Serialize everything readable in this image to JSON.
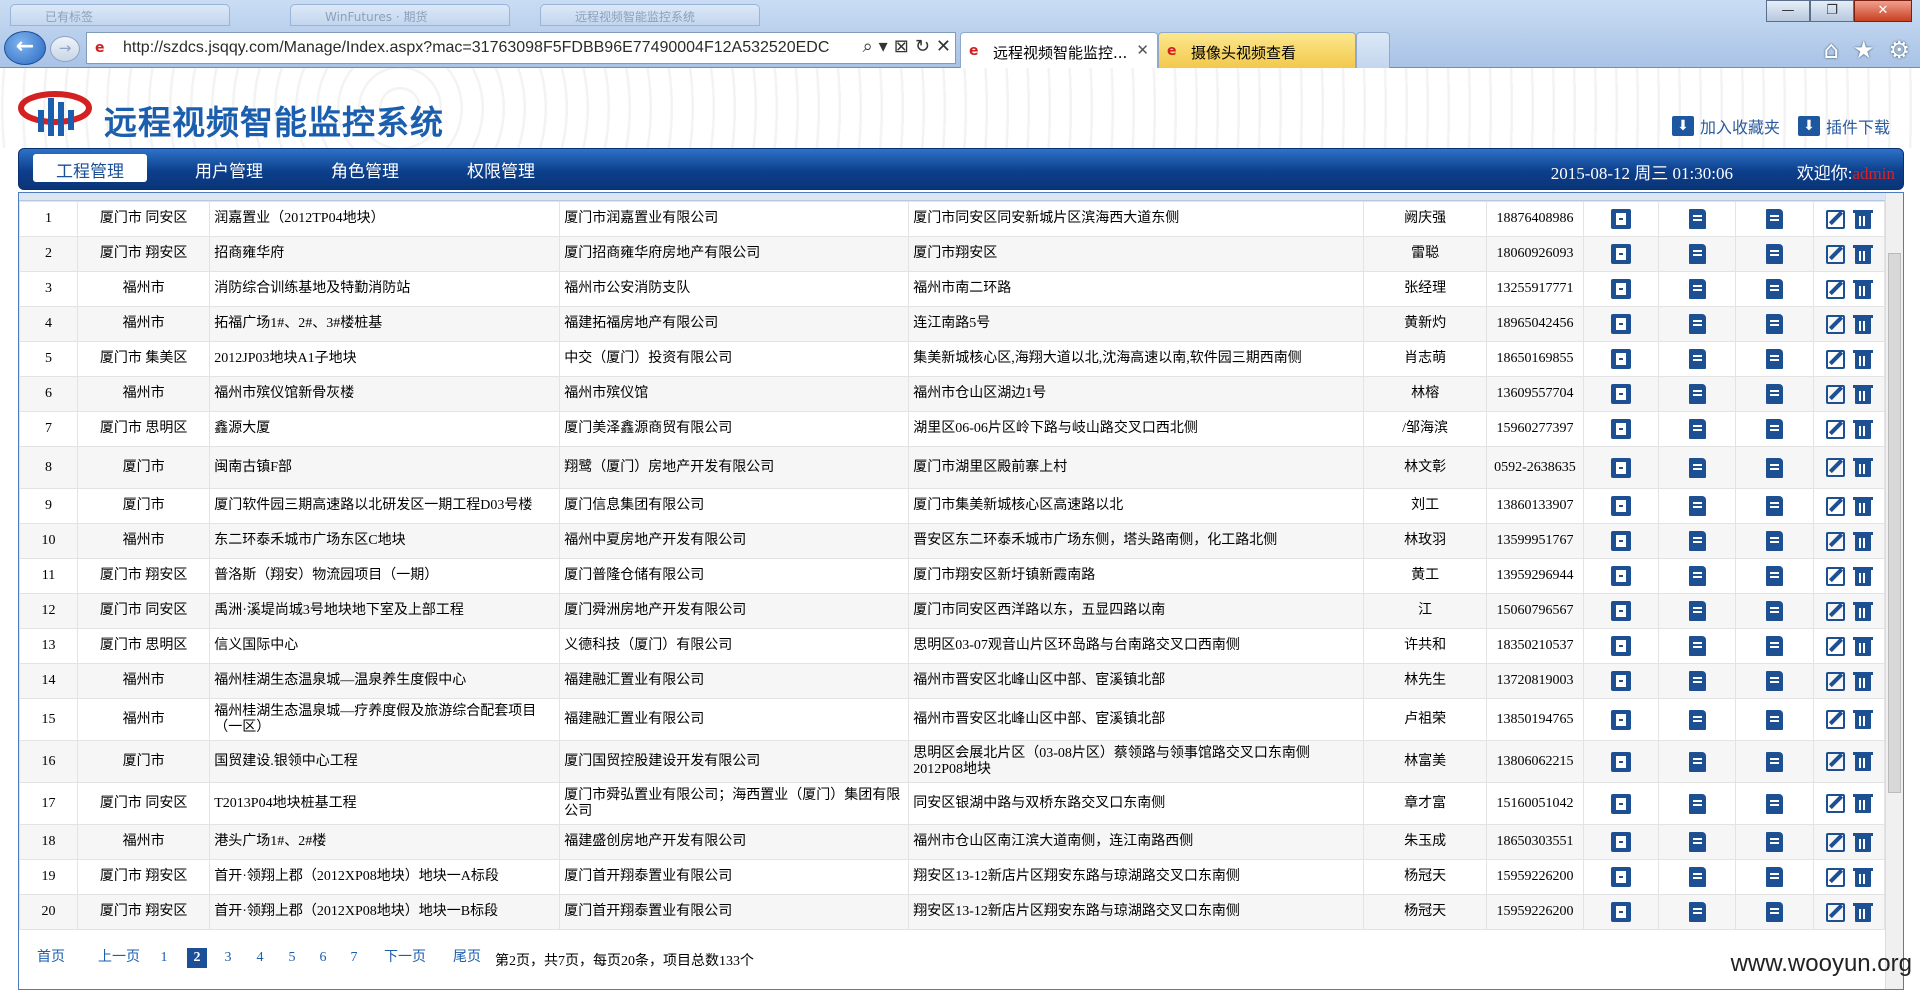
{
  "browser": {
    "back_glyph": "←",
    "forward_glyph": "→",
    "address": "http://szdcs.jsqqy.com/Manage/Index.aspx?mac=31763098F5FDBB96E77490004F12A532520EDC",
    "address_tools": [
      "⌕",
      "▾",
      "⊠",
      "↻",
      "✕"
    ],
    "old_tabs": [
      "已有标签",
      "WinFutures · 期货",
      "远程视频智能监控系统"
    ],
    "tabs": [
      {
        "label": "远程视频智能监控...",
        "active": true
      },
      {
        "label": "摄像头视频查看",
        "active": false
      }
    ],
    "window_buttons": [
      "—",
      "❐",
      "✕"
    ],
    "nav_icons": [
      "⌂",
      "★",
      "⚙"
    ]
  },
  "header": {
    "title": "远程视频智能监控系统",
    "add_favorite": "加入收藏夹",
    "plugin_download": "插件下载",
    "download_glyph": "⬇"
  },
  "navbar": {
    "menus": [
      "工程管理",
      "用户管理",
      "角色管理",
      "权限管理"
    ],
    "active_index": 0,
    "datetime": "2015-08-12 周三 01:30:06",
    "welcome_label": "欢迎你:",
    "username": "admin"
  },
  "table": {
    "rows": [
      {
        "no": "1",
        "area": "厦门市 同安区",
        "name": "润嘉置业（2012TP04地块）",
        "builder": "厦门市润嘉置业有限公司",
        "address": "厦门市同安区同安新城片区滨海西大道东侧",
        "contact": "阙庆强",
        "phone": "18876408986"
      },
      {
        "no": "2",
        "area": "厦门市 翔安区",
        "name": "招商雍华府",
        "builder": "厦门招商雍华府房地产有限公司",
        "address": "厦门市翔安区",
        "contact": "雷聪",
        "phone": "18060926093"
      },
      {
        "no": "3",
        "area": "福州市",
        "name": "消防综合训练基地及特勤消防站",
        "builder": "福州市公安消防支队",
        "address": "福州市南二环路",
        "contact": "张经理",
        "phone": "13255917771"
      },
      {
        "no": "4",
        "area": "福州市",
        "name": "拓福广场1#、2#、3#楼桩基",
        "builder": "福建拓福房地产有限公司",
        "address": "连江南路5号",
        "contact": "黄新灼",
        "phone": "18965042456"
      },
      {
        "no": "5",
        "area": "厦门市 集美区",
        "name": "2012JP03地块A1子地块",
        "builder": "中交（厦门）投资有限公司",
        "address": "集美新城核心区,海翔大道以北,沈海高速以南,软件园三期西南侧",
        "contact": "肖志萌",
        "phone": "18650169855"
      },
      {
        "no": "6",
        "area": "福州市",
        "name": "福州市殡仪馆新骨灰楼",
        "builder": "福州市殡仪馆",
        "address": "福州市仓山区湖边1号",
        "contact": "林榕",
        "phone": "13609557704"
      },
      {
        "no": "7",
        "area": "厦门市 思明区",
        "name": "鑫源大厦",
        "builder": "厦门美泽鑫源商贸有限公司",
        "address": "湖里区06-06片区岭下路与岐山路交叉口西北侧",
        "contact": "/邹海滨",
        "phone": "15960277397"
      },
      {
        "no": "8",
        "area": "厦门市",
        "name": "闽南古镇F部",
        "builder": "翔鹭（厦门）房地产开发有限公司",
        "address": "厦门市湖里区殿前寨上村",
        "contact": "林文彰",
        "phone": "0592-2638635"
      },
      {
        "no": "9",
        "area": "厦门市",
        "name": "厦门软件园三期高速路以北研发区一期工程D03号楼",
        "builder": "厦门信息集团有限公司",
        "address": "厦门市集美新城核心区高速路以北",
        "contact": "刘工",
        "phone": "13860133907"
      },
      {
        "no": "10",
        "area": "福州市",
        "name": "东二环泰禾城市广场东区C地块",
        "builder": "福州中夏房地产开发有限公司",
        "address": "晋安区东二环泰禾城市广场东侧，塔头路南侧，化工路北侧",
        "contact": "林玫羽",
        "phone": "13599951767"
      },
      {
        "no": "11",
        "area": "厦门市 翔安区",
        "name": "普洛斯（翔安）物流园项目（一期）",
        "builder": "厦门普隆仓储有限公司",
        "address": "厦门市翔安区新圩镇新霞南路",
        "contact": "黄工",
        "phone": "13959296944"
      },
      {
        "no": "12",
        "area": "厦门市 同安区",
        "name": "禹洲·溪堤尚城3号地块地下室及上部工程",
        "builder": "厦门舜洲房地产开发有限公司",
        "address": "厦门市同安区西洋路以东，五显四路以南",
        "contact": "江",
        "phone": "15060796567"
      },
      {
        "no": "13",
        "area": "厦门市 思明区",
        "name": "信义国际中心",
        "builder": "义德科技（厦门）有限公司",
        "address": "思明区03-07观音山片区环岛路与台南路交叉口西南侧",
        "contact": "许共和",
        "phone": "18350210537"
      },
      {
        "no": "14",
        "area": "福州市",
        "name": "福州桂湖生态温泉城—温泉养生度假中心",
        "builder": "福建融汇置业有限公司",
        "address": "福州市晋安区北峰山区中部、宦溪镇北部",
        "contact": "林先生",
        "phone": "13720819003"
      },
      {
        "no": "15",
        "area": "福州市",
        "name": "福州桂湖生态温泉城—疗养度假及旅游综合配套项目（一区）",
        "builder": "福建融汇置业有限公司",
        "address": "福州市晋安区北峰山区中部、宦溪镇北部",
        "contact": "卢祖荣",
        "phone": "13850194765"
      },
      {
        "no": "16",
        "area": "厦门市",
        "name": "国贸建设.银领中心工程",
        "builder": "厦门国贸控股建设开发有限公司",
        "address": "思明区会展北片区（03-08片区）蔡领路与领事馆路交叉口东南侧2012P08地块",
        "contact": "林富美",
        "phone": "13806062215"
      },
      {
        "no": "17",
        "area": "厦门市 同安区",
        "name": "T2013P04地块桩基工程",
        "builder": "厦门市舜弘置业有限公司；海西置业（厦门）集团有限公司",
        "address": "同安区银湖中路与双桥东路交叉口东南侧",
        "contact": "章才富",
        "phone": "15160051042"
      },
      {
        "no": "18",
        "area": "福州市",
        "name": "港头广场1#、2#楼",
        "builder": "福建盛创房地产开发有限公司",
        "address": "福州市仓山区南江滨大道南侧，连江南路西侧",
        "contact": "朱玉成",
        "phone": "18650303551"
      },
      {
        "no": "19",
        "area": "厦门市 翔安区",
        "name": "首开·领翔上郡（2012XP08地块）地块一A标段",
        "builder": "厦门首开翔泰置业有限公司",
        "address": "翔安区13-12新店片区翔安东路与琼湖路交叉口东南侧",
        "contact": "杨冠天",
        "phone": "15959226200"
      },
      {
        "no": "20",
        "area": "厦门市 翔安区",
        "name": "首开·领翔上郡（2012XP08地块）地块一B标段",
        "builder": "厦门首开翔泰置业有限公司",
        "address": "翔安区13-12新店片区翔安东路与琼湖路交叉口东南侧",
        "contact": "杨冠天",
        "phone": "15959226200"
      }
    ],
    "row_icons": [
      "video-film-icon",
      "doc-icon",
      "doc-icon",
      "edit-icon",
      "delete-trash-icon"
    ]
  },
  "pager": {
    "first": "首页",
    "prev": "上一页",
    "pages": [
      "1",
      "2",
      "3",
      "4",
      "5",
      "6",
      "7"
    ],
    "current": "2",
    "next": "下一页",
    "last": "尾页",
    "info": "第2页，共7页，每页20条，项目总数133个"
  },
  "watermark": "www.wooyun.org",
  "colors": {
    "brand_blue": "#1b5eae",
    "nav_dark": "#0d3f8c",
    "icon_blue": "#1d4f93",
    "username_red": "#e02020"
  }
}
